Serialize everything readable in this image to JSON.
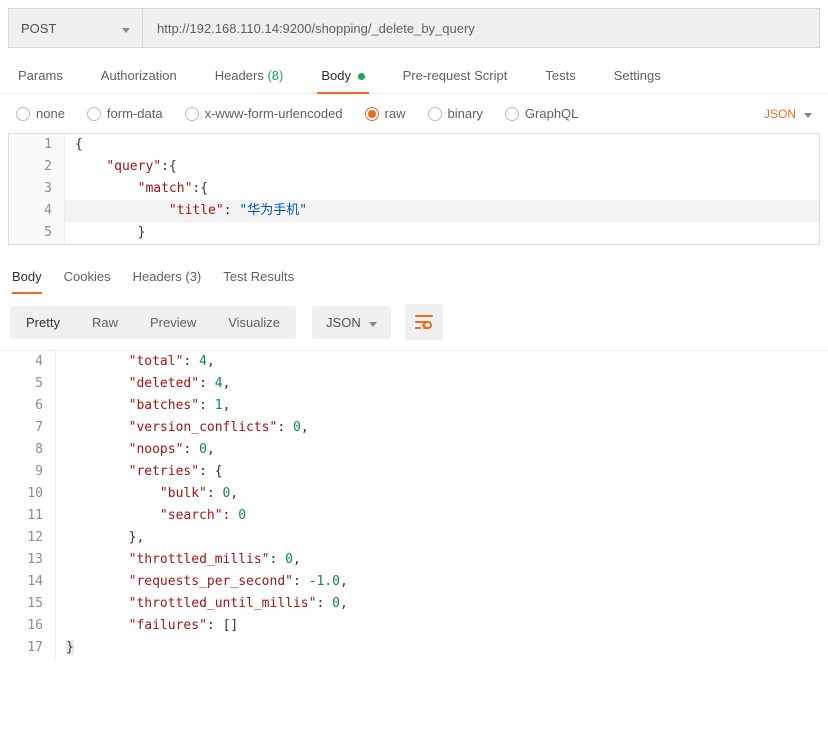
{
  "request": {
    "method": "POST",
    "url": "http://192.168.110.14:9200/shopping/_delete_by_query"
  },
  "tabs": {
    "params": "Params",
    "authorization": "Authorization",
    "headers": "Headers",
    "headers_count": "(8)",
    "body": "Body",
    "prerequest": "Pre-request Script",
    "tests": "Tests",
    "settings": "Settings"
  },
  "body_types": {
    "none": "none",
    "form_data": "form-data",
    "urlencoded": "x-www-form-urlencoded",
    "raw": "raw",
    "binary": "binary",
    "graphql": "GraphQL"
  },
  "raw_format": "JSON",
  "request_body": {
    "l1": "{",
    "l2_key": "\"query\"",
    "l3_key": "\"match\"",
    "l4_key": "\"title\"",
    "l4_val": "\"华为手机\"",
    "l5": "}"
  },
  "response_tabs": {
    "body": "Body",
    "cookies": "Cookies",
    "headers": "Headers",
    "headers_count": "(3)",
    "test_results": "Test Results"
  },
  "response_toolbar": {
    "pretty": "Pretty",
    "raw": "Raw",
    "preview": "Preview",
    "visualize": "Visualize",
    "format": "JSON"
  },
  "response_body": {
    "lines": [
      {
        "n": "4",
        "indent": 2,
        "key": "\"total\"",
        "val": "4",
        "type": "num",
        "comma": true
      },
      {
        "n": "5",
        "indent": 2,
        "key": "\"deleted\"",
        "val": "4",
        "type": "num",
        "comma": true
      },
      {
        "n": "6",
        "indent": 2,
        "key": "\"batches\"",
        "val": "1",
        "type": "num",
        "comma": true
      },
      {
        "n": "7",
        "indent": 2,
        "key": "\"version_conflicts\"",
        "val": "0",
        "type": "num",
        "comma": true
      },
      {
        "n": "8",
        "indent": 2,
        "key": "\"noops\"",
        "val": "0",
        "type": "num",
        "comma": true
      },
      {
        "n": "9",
        "indent": 2,
        "key": "\"retries\"",
        "val": "{",
        "type": "brace",
        "comma": false
      },
      {
        "n": "10",
        "indent": 3,
        "key": "\"bulk\"",
        "val": "0",
        "type": "num",
        "comma": true
      },
      {
        "n": "11",
        "indent": 3,
        "key": "\"search\"",
        "val": "0",
        "type": "num",
        "comma": false
      },
      {
        "n": "12",
        "indent": 2,
        "key": "",
        "val": "}",
        "type": "brace",
        "comma": true
      },
      {
        "n": "13",
        "indent": 2,
        "key": "\"throttled_millis\"",
        "val": "0",
        "type": "num",
        "comma": true
      },
      {
        "n": "14",
        "indent": 2,
        "key": "\"requests_per_second\"",
        "val": "-1.0",
        "type": "num",
        "comma": true
      },
      {
        "n": "15",
        "indent": 2,
        "key": "\"throttled_until_millis\"",
        "val": "0",
        "type": "num",
        "comma": true
      },
      {
        "n": "16",
        "indent": 2,
        "key": "\"failures\"",
        "val": "[]",
        "type": "brace",
        "comma": false
      },
      {
        "n": "17",
        "indent": 0,
        "key": "",
        "val": "}",
        "type": "brace",
        "comma": false
      }
    ]
  }
}
